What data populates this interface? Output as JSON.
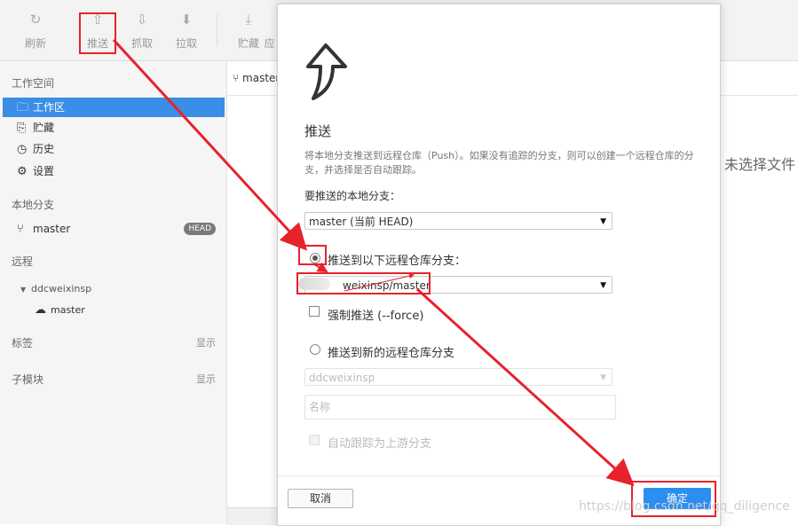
{
  "toolbar": {
    "items": [
      {
        "label": "刷新",
        "icon": "refresh-icon"
      },
      {
        "label": "推送",
        "icon": "push-icon"
      },
      {
        "label": "抓取",
        "icon": "fetch-icon"
      },
      {
        "label": "拉取",
        "icon": "pull-icon"
      },
      {
        "label": "贮藏",
        "icon": "stash-icon"
      },
      {
        "label": "应",
        "icon": "apply-icon"
      }
    ]
  },
  "sidebar": {
    "workspace_header": "工作空间",
    "workspace_items": [
      {
        "label": "工作区",
        "icon": "folder-icon"
      },
      {
        "label": "贮藏",
        "icon": "stash-icon"
      },
      {
        "label": "历史",
        "icon": "history-icon"
      },
      {
        "label": "设置",
        "icon": "gear-icon"
      }
    ],
    "local_header": "本地分支",
    "local_branch": "master",
    "head_badge": "HEAD",
    "remote_header": "远程",
    "remote_name": "ddcweixinsp",
    "remote_branch": "master",
    "tags_header": "标签",
    "tags_toggle": "显示",
    "submodules_header": "子模块",
    "submodules_toggle": "显示"
  },
  "main": {
    "tab_label": "master",
    "empty_message": "未选择文件"
  },
  "dialog": {
    "title": "推送",
    "description": "将本地分支推送到远程仓库（Push）。如果没有追踪的分支，则可以创建一个远程仓库的分支，并选择是否自动跟踪。",
    "local_branch_label": "要推送的本地分支：",
    "local_branch_value": "master (当前 HEAD)",
    "push_existing_label": "推送到以下远程仓库分支：",
    "remote_branch_value": "weixinsp/master",
    "force_label": "强制推送 (--force)",
    "push_new_label": "推送到新的远程仓库分支",
    "new_remote_value": "ddcweixinsp",
    "name_placeholder": "名称",
    "track_label": "自动跟踪为上游分支",
    "cancel_label": "取消",
    "ok_label": "确定"
  },
  "watermark": "https://blog.csdn.net/qq_diligence",
  "colors": {
    "accent": "#3a8ee6",
    "ok_button": "#2b8ef0",
    "annotation_red": "#e8222a"
  }
}
